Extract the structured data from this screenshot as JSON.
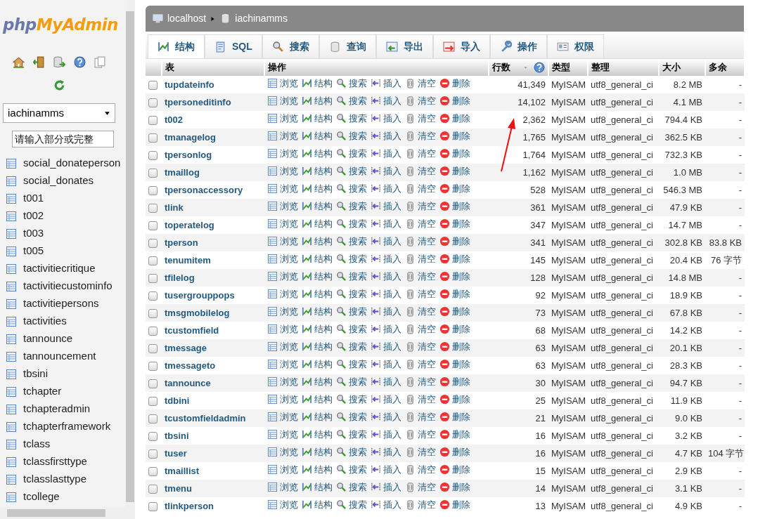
{
  "sidebar": {
    "logo": {
      "part_1": "php",
      "part_2": "MyAdmin"
    },
    "database_select": {
      "value": "iachinamms"
    },
    "filter": {
      "placeholder": "请输入部分或完整"
    },
    "tables": [
      {
        "name": "social_donateperson"
      },
      {
        "name": "social_donates"
      },
      {
        "name": "t001"
      },
      {
        "name": "t002"
      },
      {
        "name": "t003"
      },
      {
        "name": "t005"
      },
      {
        "name": "tactivitiecritique"
      },
      {
        "name": "tactivitiecustominfo"
      },
      {
        "name": "tactivitiepersons"
      },
      {
        "name": "tactivities"
      },
      {
        "name": "tannounce"
      },
      {
        "name": "tannouncement"
      },
      {
        "name": "tbsini"
      },
      {
        "name": "tchapter"
      },
      {
        "name": "tchapteradmin"
      },
      {
        "name": "tchapterframework"
      },
      {
        "name": "tclass"
      },
      {
        "name": "tclassfirsttype"
      },
      {
        "name": "tclasslasttype"
      },
      {
        "name": "tcollege"
      }
    ]
  },
  "breadcrumb": [
    "localhost",
    "iachinamms"
  ],
  "tabs": [
    {
      "label": "结构",
      "selected": true
    },
    {
      "label": "SQL",
      "selected": false
    },
    {
      "label": "搜索",
      "selected": false
    },
    {
      "label": "查询",
      "selected": false
    },
    {
      "label": "导出",
      "selected": false
    },
    {
      "label": "导入",
      "selected": false
    },
    {
      "label": "操作",
      "selected": false
    },
    {
      "label": "权限",
      "selected": false
    }
  ],
  "table": {
    "columns": [
      "表",
      "操作",
      "行数",
      "类型",
      "整理",
      "大小",
      "多余"
    ],
    "rows": [
      {
        "checked": false,
        "name": "tupdateinfo",
        "actions": [
          "浏览",
          "结构",
          "搜索",
          "插入",
          "清空",
          "删除"
        ],
        "rows": "41,349",
        "type": "MyISAM",
        "collation": "utf8_general_ci",
        "size": "8.2 MB",
        "overhead": "-"
      },
      {
        "checked": false,
        "name": "tpersoneditinfo",
        "actions": [
          "浏览",
          "结构",
          "搜索",
          "插入",
          "清空",
          "删除"
        ],
        "rows": "14,102",
        "type": "MyISAM",
        "collation": "utf8_general_ci",
        "size": "4.1 MB",
        "overhead": "-"
      },
      {
        "checked": false,
        "name": "t002",
        "actions": [
          "浏览",
          "结构",
          "搜索",
          "插入",
          "清空",
          "删除"
        ],
        "rows": "2,362",
        "type": "MyISAM",
        "collation": "utf8_general_ci",
        "size": "794.4 KB",
        "overhead": "-"
      },
      {
        "checked": false,
        "name": "tmanagelog",
        "actions": [
          "浏览",
          "结构",
          "搜索",
          "插入",
          "清空",
          "删除"
        ],
        "rows": "1,765",
        "type": "MyISAM",
        "collation": "utf8_general_ci",
        "size": "362.5 KB",
        "overhead": "-"
      },
      {
        "checked": false,
        "name": "tpersonlog",
        "actions": [
          "浏览",
          "结构",
          "搜索",
          "插入",
          "清空",
          "删除"
        ],
        "rows": "1,764",
        "type": "MyISAM",
        "collation": "utf8_general_ci",
        "size": "732.3 KB",
        "overhead": "-"
      },
      {
        "checked": false,
        "name": "tmaillog",
        "actions": [
          "浏览",
          "结构",
          "搜索",
          "插入",
          "清空",
          "删除"
        ],
        "rows": "1,162",
        "type": "MyISAM",
        "collation": "utf8_general_ci",
        "size": "1.0 MB",
        "overhead": "-"
      },
      {
        "checked": false,
        "name": "tpersonaccessory",
        "actions": [
          "浏览",
          "结构",
          "搜索",
          "插入",
          "清空",
          "删除"
        ],
        "rows": "528",
        "type": "MyISAM",
        "collation": "utf8_general_ci",
        "size": "546.3 MB",
        "overhead": "-"
      },
      {
        "checked": false,
        "name": "tlink",
        "actions": [
          "浏览",
          "结构",
          "搜索",
          "插入",
          "清空",
          "删除"
        ],
        "rows": "361",
        "type": "MyISAM",
        "collation": "utf8_general_ci",
        "size": "47.9 KB",
        "overhead": "-"
      },
      {
        "checked": false,
        "name": "toperatelog",
        "actions": [
          "浏览",
          "结构",
          "搜索",
          "插入",
          "清空",
          "删除"
        ],
        "rows": "347",
        "type": "MyISAM",
        "collation": "utf8_general_ci",
        "size": "14.7 MB",
        "overhead": "-"
      },
      {
        "checked": false,
        "name": "tperson",
        "actions": [
          "浏览",
          "结构",
          "搜索",
          "插入",
          "清空",
          "删除"
        ],
        "rows": "341",
        "type": "MyISAM",
        "collation": "utf8_general_ci",
        "size": "302.8 KB",
        "overhead": "83.8 KB"
      },
      {
        "checked": false,
        "name": "tenumitem",
        "actions": [
          "浏览",
          "结构",
          "搜索",
          "插入",
          "清空",
          "删除"
        ],
        "rows": "145",
        "type": "MyISAM",
        "collation": "utf8_general_ci",
        "size": "20.4 KB",
        "overhead": "76 字节"
      },
      {
        "checked": false,
        "name": "tfilelog",
        "actions": [
          "浏览",
          "结构",
          "搜索",
          "插入",
          "清空",
          "删除"
        ],
        "rows": "128",
        "type": "MyISAM",
        "collation": "utf8_general_ci",
        "size": "14.8 MB",
        "overhead": "-"
      },
      {
        "checked": false,
        "name": "tusergrouppops",
        "actions": [
          "浏览",
          "结构",
          "搜索",
          "插入",
          "清空",
          "删除"
        ],
        "rows": "92",
        "type": "MyISAM",
        "collation": "utf8_general_ci",
        "size": "18.9 KB",
        "overhead": "-"
      },
      {
        "checked": false,
        "name": "tmsgmobilelog",
        "actions": [
          "浏览",
          "结构",
          "搜索",
          "插入",
          "清空",
          "删除"
        ],
        "rows": "73",
        "type": "MyISAM",
        "collation": "utf8_general_ci",
        "size": "67.8 KB",
        "overhead": "-"
      },
      {
        "checked": false,
        "name": "tcustomfield",
        "actions": [
          "浏览",
          "结构",
          "搜索",
          "插入",
          "清空",
          "删除"
        ],
        "rows": "68",
        "type": "MyISAM",
        "collation": "utf8_general_ci",
        "size": "14.2 KB",
        "overhead": "-"
      },
      {
        "checked": false,
        "name": "tmessage",
        "actions": [
          "浏览",
          "结构",
          "搜索",
          "插入",
          "清空",
          "删除"
        ],
        "rows": "63",
        "type": "MyISAM",
        "collation": "utf8_general_ci",
        "size": "20.1 KB",
        "overhead": "-"
      },
      {
        "checked": false,
        "name": "tmessageto",
        "actions": [
          "浏览",
          "结构",
          "搜索",
          "插入",
          "清空",
          "删除"
        ],
        "rows": "63",
        "type": "MyISAM",
        "collation": "utf8_general_ci",
        "size": "28.3 KB",
        "overhead": "-"
      },
      {
        "checked": false,
        "name": "tannounce",
        "actions": [
          "浏览",
          "结构",
          "搜索",
          "插入",
          "清空",
          "删除"
        ],
        "rows": "30",
        "type": "MyISAM",
        "collation": "utf8_general_ci",
        "size": "94.7 KB",
        "overhead": "-"
      },
      {
        "checked": false,
        "name": "tdbini",
        "actions": [
          "浏览",
          "结构",
          "搜索",
          "插入",
          "清空",
          "删除"
        ],
        "rows": "25",
        "type": "MyISAM",
        "collation": "utf8_general_ci",
        "size": "11.9 KB",
        "overhead": "-"
      },
      {
        "checked": false,
        "name": "tcustomfieldadmin",
        "actions": [
          "浏览",
          "结构",
          "搜索",
          "插入",
          "清空",
          "删除"
        ],
        "rows": "21",
        "type": "MyISAM",
        "collation": "utf8_general_ci",
        "size": "9.0 KB",
        "overhead": "-"
      },
      {
        "checked": false,
        "name": "tbsini",
        "actions": [
          "浏览",
          "结构",
          "搜索",
          "插入",
          "清空",
          "删除"
        ],
        "rows": "16",
        "type": "MyISAM",
        "collation": "utf8_general_ci",
        "size": "3.2 KB",
        "overhead": "-"
      },
      {
        "checked": false,
        "name": "tuser",
        "actions": [
          "浏览",
          "结构",
          "搜索",
          "插入",
          "清空",
          "删除"
        ],
        "rows": "16",
        "type": "MyISAM",
        "collation": "utf8_general_ci",
        "size": "4.7 KB",
        "overhead": "104 字节"
      },
      {
        "checked": false,
        "name": "tmaillist",
        "actions": [
          "浏览",
          "结构",
          "搜索",
          "插入",
          "清空",
          "删除"
        ],
        "rows": "15",
        "type": "MyISAM",
        "collation": "utf8_general_ci",
        "size": "2.9 KB",
        "overhead": "-"
      },
      {
        "checked": false,
        "name": "tmenu",
        "actions": [
          "浏览",
          "结构",
          "搜索",
          "插入",
          "清空",
          "删除"
        ],
        "rows": "14",
        "type": "MyISAM",
        "collation": "utf8_general_ci",
        "size": "3.1 KB",
        "overhead": "-"
      },
      {
        "checked": false,
        "name": "tlinkperson",
        "actions": [
          "浏览",
          "结构",
          "搜索",
          "插入",
          "清空",
          "删除"
        ],
        "rows": "13",
        "type": "MyISAM",
        "collation": "utf8_general_ci",
        "size": "4.9 KB",
        "overhead": "-"
      }
    ]
  }
}
